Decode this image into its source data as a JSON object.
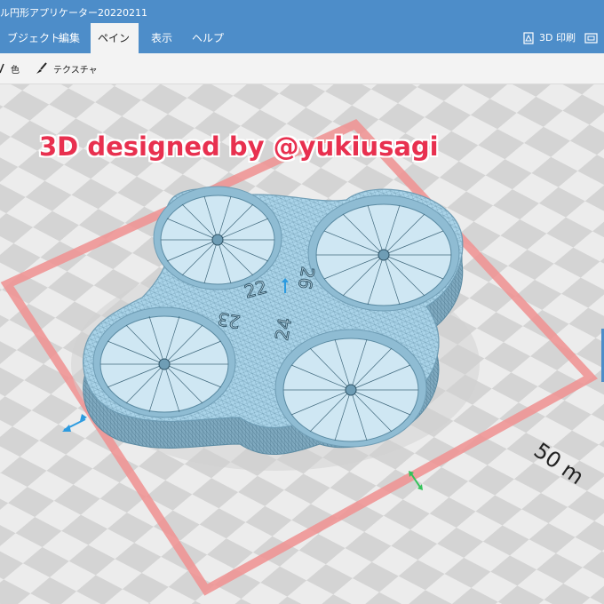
{
  "window": {
    "title": "ル円形アプリケーター20220211"
  },
  "ribbon": {
    "tabs": [
      "ブジェクト",
      "編集",
      "ペイント",
      "表示",
      "ヘルプ"
    ],
    "active_tab": "ペイント",
    "print_button": "3D 印刷"
  },
  "toolbar": {
    "color_label": "色",
    "texture_label": "テクスチャ"
  },
  "viewport": {
    "overlay_text": "3D designed by @yukiusagi",
    "dimension_label": "50 m",
    "model_labels": [
      "22",
      "26",
      "23",
      "24"
    ],
    "colors": {
      "model": "#a9d3e8",
      "mesh": "#4f7d95",
      "bed_outline": "#f09090",
      "grid_dark": "#d4d4d4",
      "grid_light": "#ececec"
    }
  }
}
